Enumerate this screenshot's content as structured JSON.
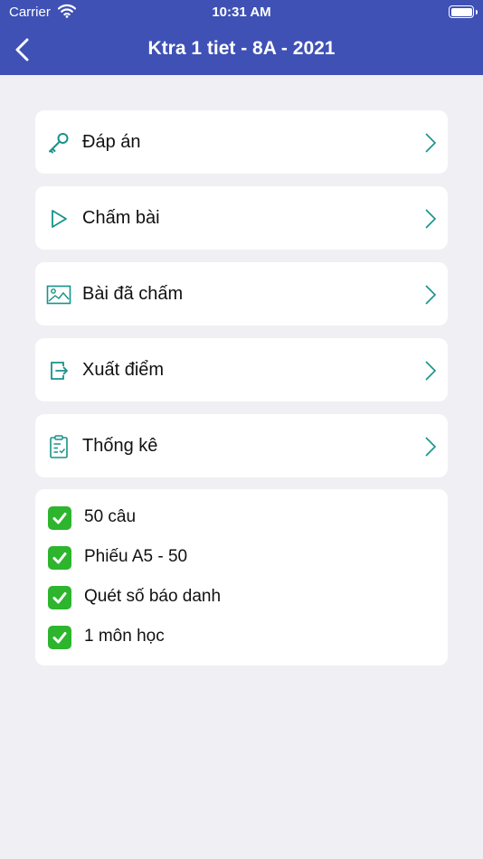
{
  "status_bar": {
    "carrier": "Carrier",
    "time": "10:31 AM"
  },
  "nav": {
    "title": "Ktra 1 tiet - 8A - 2021"
  },
  "menu": [
    {
      "label": "Đáp án",
      "icon": "key-icon"
    },
    {
      "label": "Chấm bài",
      "icon": "play-icon"
    },
    {
      "label": "Bài đã chấm",
      "icon": "image-icon"
    },
    {
      "label": "Xuất điểm",
      "icon": "export-icon"
    },
    {
      "label": "Thống kê",
      "icon": "clipboard-checklist-icon"
    }
  ],
  "info": {
    "items": [
      "50 câu",
      "Phiếu A5 - 50",
      "Quét số báo danh",
      "1 môn học"
    ]
  },
  "colors": {
    "header": "#3f51b5",
    "background": "#efeff4",
    "icon_teal": "#17928a",
    "check_green": "#2db52d"
  }
}
